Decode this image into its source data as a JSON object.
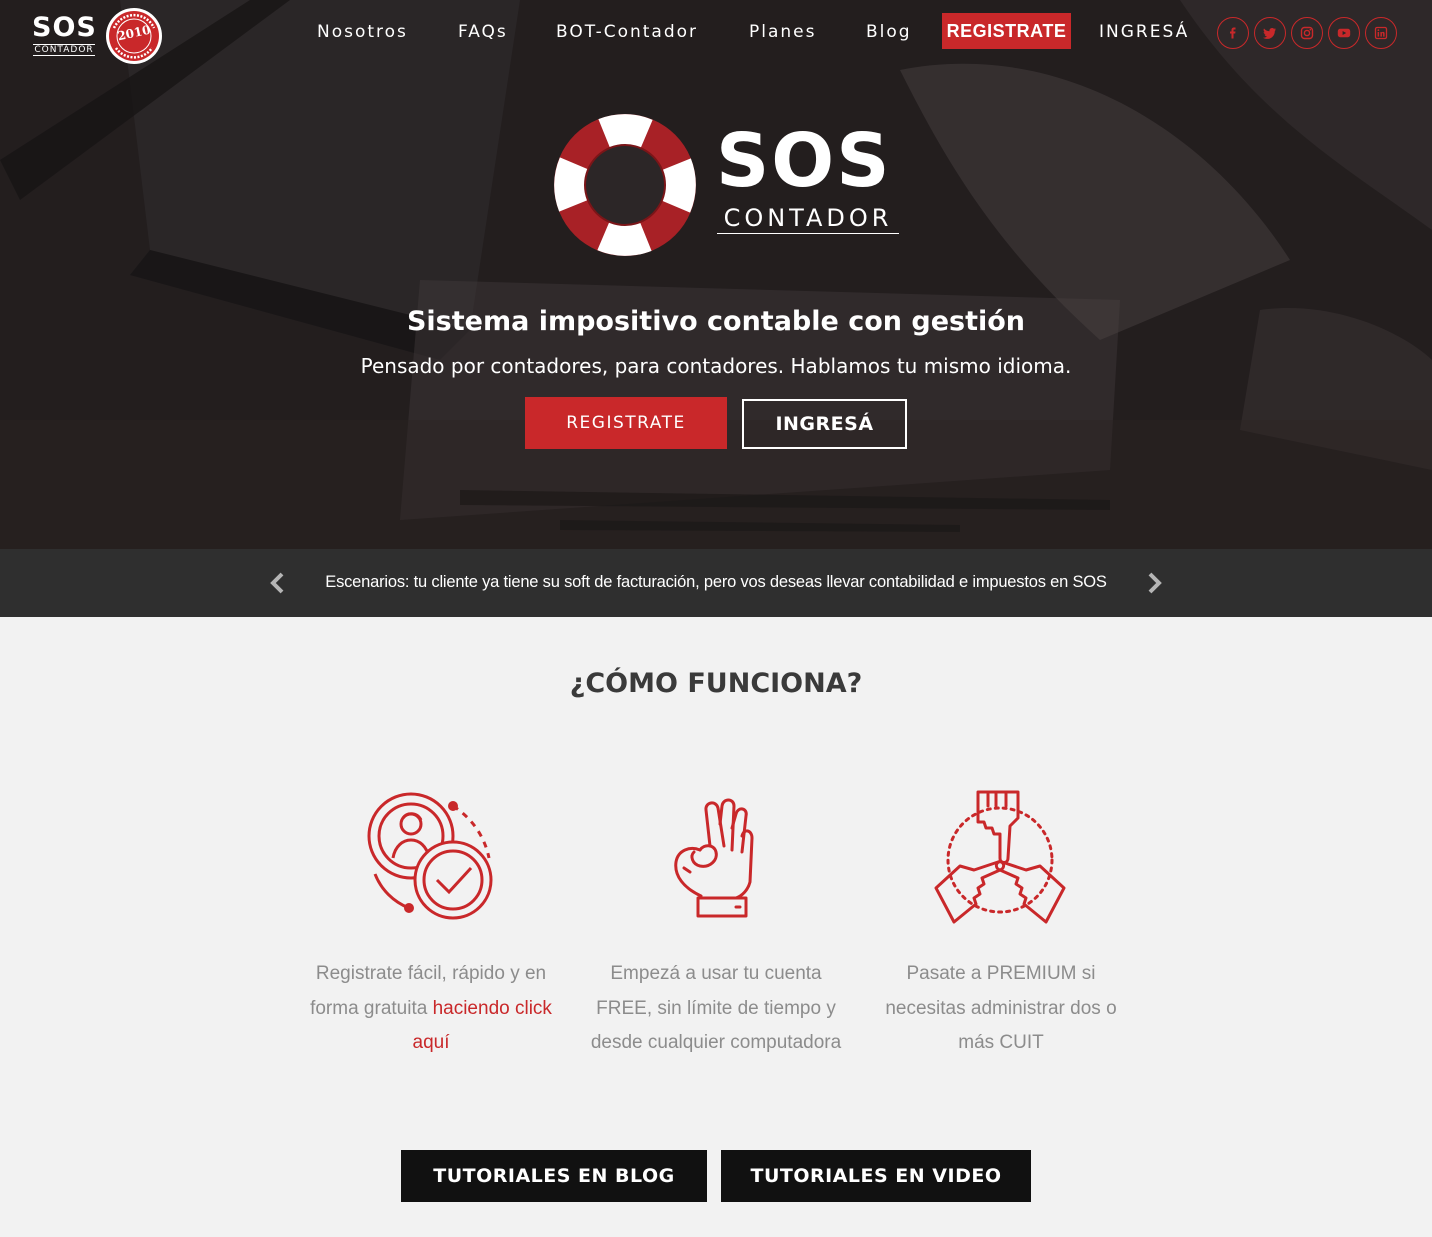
{
  "brand": {
    "logo_text": "SOS",
    "logo_subtext": "CONTADOR",
    "badge_year": "2010",
    "badge_ring_text": "CUMPLIENDO DESDE 2010"
  },
  "nav": {
    "links": [
      "Nosotros",
      "FAQs",
      "BOT-Contador",
      "Planes",
      "Blog"
    ],
    "register_label": "REGISTRATE",
    "login_label": "INGRESÁ",
    "social_icons": [
      "facebook-icon",
      "twitter-icon",
      "instagram-icon",
      "youtube-icon",
      "linkedin-icon"
    ]
  },
  "hero": {
    "logo_text": "SOS",
    "logo_subtext": "CONTADOR",
    "title": "Sistema impositivo contable con gestión",
    "subtitle": "Pensado por contadores, para contadores. Hablamos tu mismo idioma.",
    "register_button": "REGISTRATE",
    "login_button": "INGRESÁ"
  },
  "ticker": {
    "text": "Escenarios: tu cliente ya tiene su soft de facturación, pero vos deseas llevar contabilidad e impuestos en SOS"
  },
  "how": {
    "title": "¿CÓMO FUNCIONA?",
    "features": [
      {
        "icon": "user-check-icon",
        "text": "Registrate fácil, rápido y en forma gratuita ",
        "link": "haciendo click aquí"
      },
      {
        "icon": "ok-hand-icon",
        "text": "Empezá a usar tu cuenta FREE, sin límite de tiempo y desde cualquier computadora"
      },
      {
        "icon": "hands-cycle-icon",
        "text": "Pasate a PREMIUM si necesitas administrar dos o más CUIT"
      }
    ],
    "blog_button": "TUTORIALES EN BLOG",
    "video_button": "TUTORIALES EN VIDEO"
  },
  "colors": {
    "accent": "#c9282a",
    "ticker_bg": "#2f2f2f",
    "page_bg": "#f2f2f2",
    "dark_button": "#111111"
  }
}
